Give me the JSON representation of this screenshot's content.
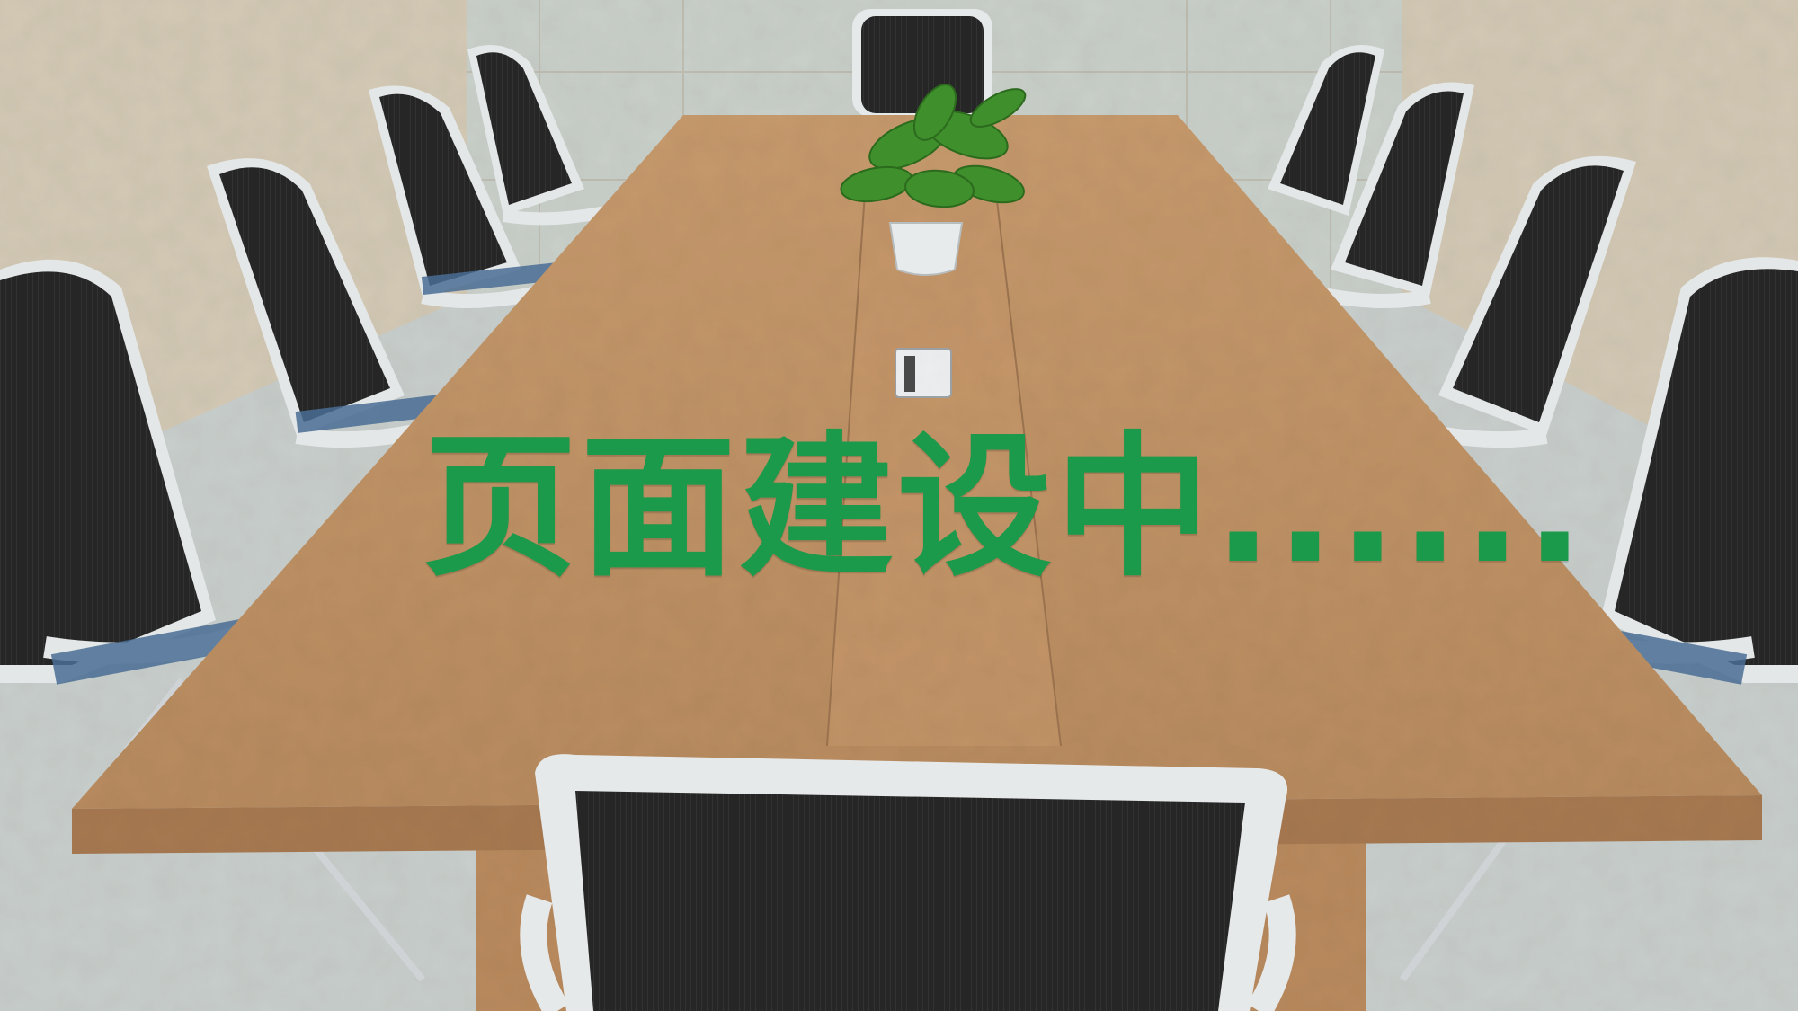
{
  "notice": {
    "text": "页面建设中......"
  },
  "colors": {
    "notice_text": "#1a9a4a",
    "table_top": "#c09468",
    "table_edge": "#a9794f",
    "wall": "#cfc7b6",
    "floor": "#c9cfcc",
    "chair_mesh": "#262626",
    "chair_frame": "#e9ecee",
    "chair_seat": "#4a6d94",
    "plant_leaf": "#3f8f2c"
  },
  "scene": {
    "description_keys": [
      "meeting-room",
      "conference-table",
      "office-chairs",
      "potted-plant"
    ]
  }
}
